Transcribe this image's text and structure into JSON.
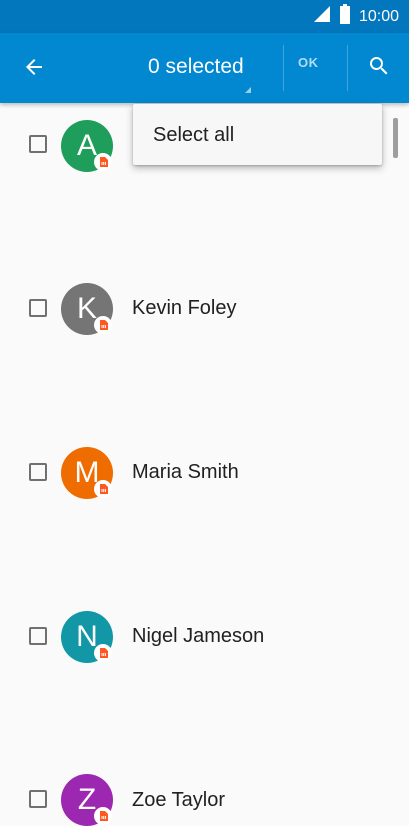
{
  "status_bar": {
    "time": "10:00",
    "icons": [
      "signal-icon",
      "battery-icon"
    ]
  },
  "app_bar": {
    "back_icon": "arrow-back-icon",
    "title": "0 selected",
    "ok_label": "OK",
    "search_icon": "search-icon"
  },
  "menu": {
    "select_all": "Select all"
  },
  "contacts": [
    {
      "initial": "A",
      "name": "",
      "color": "#1e9e5a",
      "checked": false
    },
    {
      "initial": "K",
      "name": "Kevin Foley",
      "color": "#757575",
      "checked": false
    },
    {
      "initial": "M",
      "name": "Maria Smith",
      "color": "#ef6c00",
      "checked": false
    },
    {
      "initial": "N",
      "name": "Nigel Jameson",
      "color": "#1197a5",
      "checked": false
    },
    {
      "initial": "Z",
      "name": "Zoe Taylor",
      "color": "#9c27b0",
      "checked": false
    }
  ],
  "colors": {
    "status_bar": "#0277bd",
    "app_bar": "#0288d1",
    "sim_badge": "#ff5722"
  }
}
